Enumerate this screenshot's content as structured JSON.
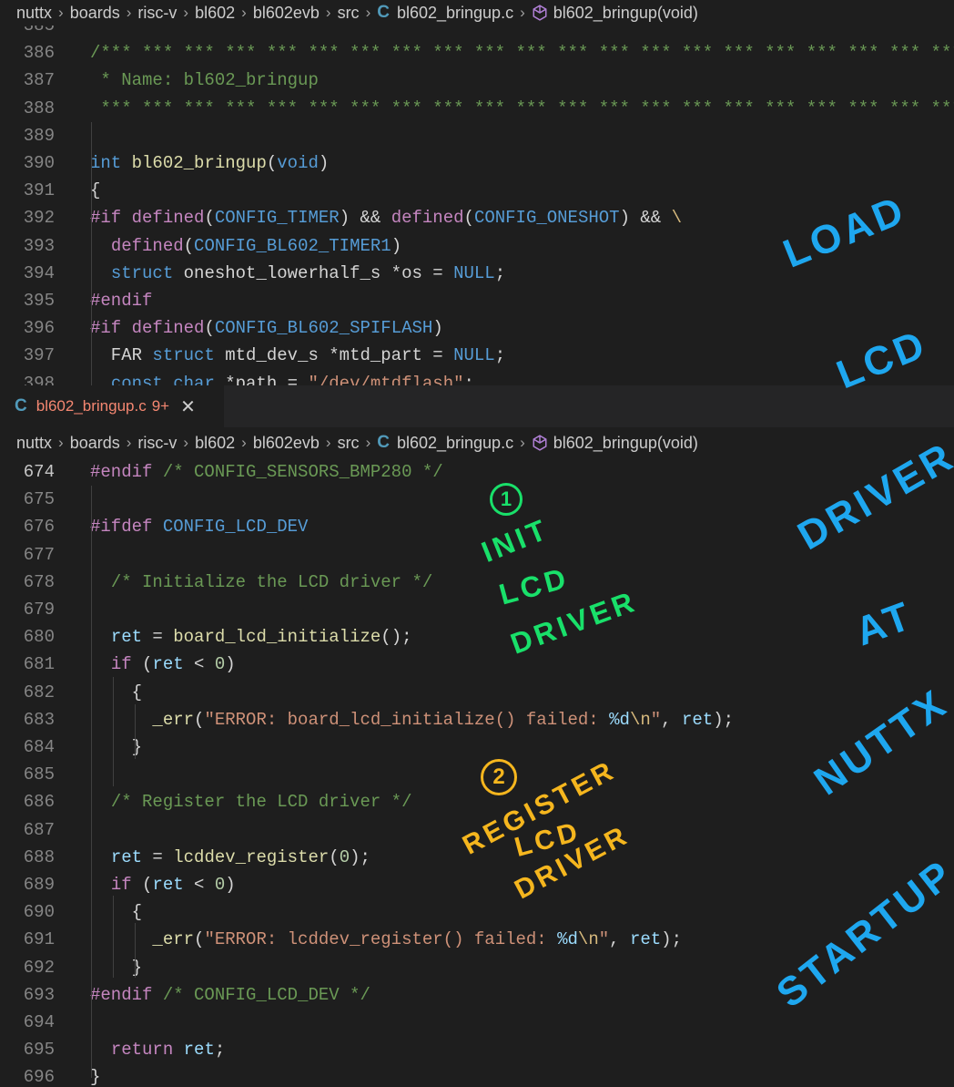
{
  "top_breadcrumb": [
    "nuttx",
    "boards",
    "risc-v",
    "bl602",
    "bl602evb",
    "src",
    "bl602_bringup.c",
    "bl602_bringup(void)"
  ],
  "top_code": [
    {
      "n": "385",
      "tokens": [
        [
          "tk-plain",
          ""
        ]
      ]
    },
    {
      "n": "386",
      "tokens": [
        [
          "tk-comment",
          "/*** *** *** *** *** *** *** *** *** *** *** *** *** *** *** *** *** *** *** *** *** *** *** *** *** *** *** ****"
        ]
      ]
    },
    {
      "n": "387",
      "tokens": [
        [
          "tk-comment",
          " * Name: bl602_bringup"
        ]
      ]
    },
    {
      "n": "388",
      "tokens": [
        [
          "tk-comment",
          " *** *** *** *** *** *** *** *** *** *** *** *** *** *** *** *** *** *** *** *** *** *** *** *** *** *** ****/"
        ]
      ]
    },
    {
      "n": "389",
      "tokens": [
        [
          "tk-plain",
          ""
        ]
      ]
    },
    {
      "n": "390",
      "tokens": [
        [
          "tk-kw",
          "int"
        ],
        [
          "tk-plain",
          " "
        ],
        [
          "tk-fn",
          "bl602_bringup"
        ],
        [
          "tk-plain",
          "("
        ],
        [
          "tk-kw",
          "void"
        ],
        [
          "tk-plain",
          ")"
        ]
      ]
    },
    {
      "n": "391",
      "tokens": [
        [
          "tk-plain",
          "{"
        ]
      ]
    },
    {
      "n": "392",
      "tokens": [
        [
          "tk-pp",
          "#if"
        ],
        [
          "tk-plain",
          " "
        ],
        [
          "tk-pp",
          "defined"
        ],
        [
          "tk-plain",
          "("
        ],
        [
          "tk-macro",
          "CONFIG_TIMER"
        ],
        [
          "tk-plain",
          ") && "
        ],
        [
          "tk-pp",
          "defined"
        ],
        [
          "tk-plain",
          "("
        ],
        [
          "tk-macro",
          "CONFIG_ONESHOT"
        ],
        [
          "tk-plain",
          ") && "
        ],
        [
          "tk-esc",
          "\\"
        ]
      ]
    },
    {
      "n": "393",
      "tokens": [
        [
          "tk-plain",
          "  "
        ],
        [
          "tk-pp",
          "defined"
        ],
        [
          "tk-plain",
          "("
        ],
        [
          "tk-macro",
          "CONFIG_BL602_TIMER1"
        ],
        [
          "tk-plain",
          ")"
        ]
      ]
    },
    {
      "n": "394",
      "tokens": [
        [
          "tk-plain",
          "  "
        ],
        [
          "tk-kw",
          "struct"
        ],
        [
          "tk-plain",
          " oneshot_lowerhalf_s *os = "
        ],
        [
          "tk-kw",
          "NULL"
        ],
        [
          "tk-plain",
          ";"
        ]
      ]
    },
    {
      "n": "395",
      "tokens": [
        [
          "tk-pp",
          "#endif"
        ]
      ]
    },
    {
      "n": "396",
      "tokens": [
        [
          "tk-pp",
          "#if"
        ],
        [
          "tk-plain",
          " "
        ],
        [
          "tk-pp",
          "defined"
        ],
        [
          "tk-plain",
          "("
        ],
        [
          "tk-macro",
          "CONFIG_BL602_SPIFLASH"
        ],
        [
          "tk-plain",
          ")"
        ]
      ]
    },
    {
      "n": "397",
      "tokens": [
        [
          "tk-plain",
          "  FAR "
        ],
        [
          "tk-kw",
          "struct"
        ],
        [
          "tk-plain",
          " mtd_dev_s *mtd_part = "
        ],
        [
          "tk-kw",
          "NULL"
        ],
        [
          "tk-plain",
          ";"
        ]
      ]
    },
    {
      "n": "398",
      "tokens": [
        [
          "tk-plain",
          "  "
        ],
        [
          "tk-kw",
          "const"
        ],
        [
          "tk-plain",
          " "
        ],
        [
          "tk-kw",
          "char"
        ],
        [
          "tk-plain",
          " *path = "
        ],
        [
          "tk-str",
          "\"/dev/mtdflash\""
        ],
        [
          "tk-plain",
          ";"
        ]
      ]
    }
  ],
  "tab": {
    "filename": "bl602_bringup.c",
    "badge": "9+",
    "close": "✕",
    "lang_icon": "C"
  },
  "bottom_breadcrumb": [
    "nuttx",
    "boards",
    "risc-v",
    "bl602",
    "bl602evb",
    "src",
    "bl602_bringup.c",
    "bl602_bringup(void)"
  ],
  "bottom_code": [
    {
      "n": "674",
      "tokens": [
        [
          "tk-pp",
          "#endif"
        ],
        [
          "tk-plain",
          " "
        ],
        [
          "tk-comment",
          "/* CONFIG_SENSORS_BMP280 */"
        ]
      ]
    },
    {
      "n": "675",
      "tokens": [
        [
          "tk-plain",
          ""
        ]
      ]
    },
    {
      "n": "676",
      "tokens": [
        [
          "tk-pp",
          "#ifdef"
        ],
        [
          "tk-plain",
          " "
        ],
        [
          "tk-macro",
          "CONFIG_LCD_DEV"
        ]
      ]
    },
    {
      "n": "677",
      "tokens": [
        [
          "tk-plain",
          ""
        ]
      ]
    },
    {
      "n": "678",
      "tokens": [
        [
          "tk-plain",
          "  "
        ],
        [
          "tk-comment",
          "/* Initialize the LCD driver */"
        ]
      ]
    },
    {
      "n": "679",
      "tokens": [
        [
          "tk-plain",
          ""
        ]
      ]
    },
    {
      "n": "680",
      "tokens": [
        [
          "tk-plain",
          "  "
        ],
        [
          "tk-var",
          "ret"
        ],
        [
          "tk-plain",
          " = "
        ],
        [
          "tk-fn",
          "board_lcd_initialize"
        ],
        [
          "tk-plain",
          "();"
        ]
      ]
    },
    {
      "n": "681",
      "tokens": [
        [
          "tk-plain",
          "  "
        ],
        [
          "tk-pp",
          "if"
        ],
        [
          "tk-plain",
          " ("
        ],
        [
          "tk-var",
          "ret"
        ],
        [
          "tk-plain",
          " < "
        ],
        [
          "tk-num",
          "0"
        ],
        [
          "tk-plain",
          ")"
        ]
      ]
    },
    {
      "n": "682",
      "tokens": [
        [
          "tk-plain",
          "    {"
        ]
      ]
    },
    {
      "n": "683",
      "tokens": [
        [
          "tk-plain",
          "      "
        ],
        [
          "tk-fn",
          "_err"
        ],
        [
          "tk-plain",
          "("
        ],
        [
          "tk-str",
          "\"ERROR: board_lcd_initialize() failed: "
        ],
        [
          "tk-var",
          "%d"
        ],
        [
          "tk-esc",
          "\\n"
        ],
        [
          "tk-str",
          "\""
        ],
        [
          "tk-plain",
          ", "
        ],
        [
          "tk-var",
          "ret"
        ],
        [
          "tk-plain",
          ");"
        ]
      ]
    },
    {
      "n": "684",
      "tokens": [
        [
          "tk-plain",
          "    }"
        ]
      ]
    },
    {
      "n": "685",
      "tokens": [
        [
          "tk-plain",
          ""
        ]
      ]
    },
    {
      "n": "686",
      "tokens": [
        [
          "tk-plain",
          "  "
        ],
        [
          "tk-comment",
          "/* Register the LCD driver */"
        ]
      ]
    },
    {
      "n": "687",
      "tokens": [
        [
          "tk-plain",
          ""
        ]
      ]
    },
    {
      "n": "688",
      "tokens": [
        [
          "tk-plain",
          "  "
        ],
        [
          "tk-var",
          "ret"
        ],
        [
          "tk-plain",
          " = "
        ],
        [
          "tk-fn",
          "lcddev_register"
        ],
        [
          "tk-plain",
          "("
        ],
        [
          "tk-num",
          "0"
        ],
        [
          "tk-plain",
          ");"
        ]
      ]
    },
    {
      "n": "689",
      "tokens": [
        [
          "tk-plain",
          "  "
        ],
        [
          "tk-pp",
          "if"
        ],
        [
          "tk-plain",
          " ("
        ],
        [
          "tk-var",
          "ret"
        ],
        [
          "tk-plain",
          " < "
        ],
        [
          "tk-num",
          "0"
        ],
        [
          "tk-plain",
          ")"
        ]
      ]
    },
    {
      "n": "690",
      "tokens": [
        [
          "tk-plain",
          "    {"
        ]
      ]
    },
    {
      "n": "691",
      "tokens": [
        [
          "tk-plain",
          "      "
        ],
        [
          "tk-fn",
          "_err"
        ],
        [
          "tk-plain",
          "("
        ],
        [
          "tk-str",
          "\"ERROR: lcddev_register() failed: "
        ],
        [
          "tk-var",
          "%d"
        ],
        [
          "tk-esc",
          "\\n"
        ],
        [
          "tk-str",
          "\""
        ],
        [
          "tk-plain",
          ", "
        ],
        [
          "tk-var",
          "ret"
        ],
        [
          "tk-plain",
          ");"
        ]
      ]
    },
    {
      "n": "692",
      "tokens": [
        [
          "tk-plain",
          "    }"
        ]
      ]
    },
    {
      "n": "693",
      "tokens": [
        [
          "tk-pp",
          "#endif"
        ],
        [
          "tk-plain",
          " "
        ],
        [
          "tk-comment",
          "/* CONFIG_LCD_DEV */"
        ]
      ]
    },
    {
      "n": "694",
      "tokens": [
        [
          "tk-plain",
          ""
        ]
      ]
    },
    {
      "n": "695",
      "tokens": [
        [
          "tk-plain",
          "  "
        ],
        [
          "tk-pp",
          "return"
        ],
        [
          "tk-plain",
          " "
        ],
        [
          "tk-var",
          "ret"
        ],
        [
          "tk-plain",
          ";"
        ]
      ]
    },
    {
      "n": "696",
      "tokens": [
        [
          "tk-plain",
          "}"
        ]
      ]
    }
  ],
  "annotations": {
    "step1_number": "1",
    "step1_text": [
      "INIT",
      "LCD",
      "DRIVER"
    ],
    "step2_number": "2",
    "step2_text": [
      "REGISTER",
      "LCD",
      "DRIVER"
    ],
    "side": [
      "LOAD",
      "LCD",
      "DRIVER",
      "AT",
      "NUTTX",
      "STARTUP"
    ]
  },
  "colors": {
    "background": "#1e1e1e",
    "note_blue": "#1ea7ef",
    "note_green": "#19e06a",
    "note_yellow": "#f5b61e"
  }
}
